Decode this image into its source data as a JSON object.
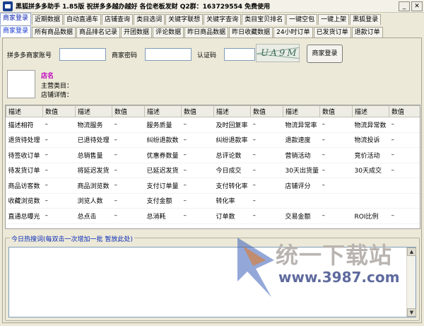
{
  "window": {
    "title": "黑狐拼多多助手   1.85版   祝拼多多越办越好   各位老板发财   Q2群：163729554 免费使用",
    "min_glyph": "_",
    "close_glyph": "✕"
  },
  "main_tabs": [
    {
      "label": "商家登录",
      "active": true
    },
    {
      "label": "近期数据"
    },
    {
      "label": "自动直通车"
    },
    {
      "label": "店铺查询"
    },
    {
      "label": "类目选词"
    },
    {
      "label": "关键字联想"
    },
    {
      "label": "关键字查询"
    },
    {
      "label": "类目宝贝排名"
    },
    {
      "label": "一键空包"
    },
    {
      "label": "一键上架"
    },
    {
      "label": "黑狐登录"
    }
  ],
  "sub_tabs": [
    {
      "label": "商家登录",
      "active": true
    },
    {
      "label": "所有商品数据"
    },
    {
      "label": "商品排名记录"
    },
    {
      "label": "开团数据"
    },
    {
      "label": "评论数据"
    },
    {
      "label": "昨日商品数据"
    },
    {
      "label": "昨日收藏数据"
    },
    {
      "label": "24小时订单"
    },
    {
      "label": "已发货订单"
    },
    {
      "label": "退款订单"
    }
  ],
  "login": {
    "account_label": "拼多多商家账号",
    "account_value": "",
    "password_label": "商家密码",
    "password_value": "",
    "captcha_label": "认证码",
    "captcha_value": "",
    "captcha_image_text": "UA9M",
    "button_label": "商家登录"
  },
  "shop": {
    "name_label": "店名",
    "category_label": "主营类目：",
    "details_label": "店铺详情："
  },
  "stats_table": {
    "headers": [
      "描述",
      "数值",
      "描述",
      "数值",
      "描述",
      "数值",
      "描述",
      "数值",
      "描述",
      "数值",
      "描述",
      "数值"
    ],
    "rows": [
      [
        "描述相符",
        "–",
        "物流服务",
        "–",
        "服务质量",
        "–",
        "及时回复率",
        "–",
        "物流异常率",
        "–",
        "物流异常数",
        "–"
      ],
      [
        "退货待处理",
        "–",
        "已退待处理",
        "–",
        "纠纷退款数",
        "–",
        "纠纷退款率",
        "–",
        "退款速度",
        "–",
        "物流投诉",
        "–"
      ],
      [
        "待签收订单",
        "–",
        "总销售量",
        "–",
        "优惠券数量",
        "–",
        "总评论数",
        "–",
        "营销活动",
        "–",
        "竞价活动",
        "–"
      ],
      [
        "待发货订单",
        "–",
        "将延迟发货",
        "–",
        "已延迟发货",
        "–",
        "今日成交",
        "–",
        "30天出货量",
        "–",
        "30天成交",
        "–"
      ],
      [
        "商品访客数",
        "–",
        "商品浏览数",
        "–",
        "支付订单量",
        "–",
        "支付转化率",
        "–",
        "店铺评分",
        "–",
        "",
        ""
      ],
      [
        "收藏浏览数",
        "–",
        "浏览人数",
        "–",
        "支付金额",
        "–",
        "转化率",
        "–",
        "",
        "",
        "",
        ""
      ],
      [
        "直通总曝光",
        "–",
        "总点击",
        "–",
        "总消耗",
        "–",
        "订单数",
        "–",
        "交易金额",
        "–",
        "ROI比例",
        "–"
      ]
    ]
  },
  "hot_words": {
    "legend": "今日热搜词(每双击一次增加一批   暂放此处)",
    "up_arrow": "▲",
    "down_arrow": "▼"
  },
  "watermark": {
    "text": "统一下载站",
    "url": "www.3987.com"
  },
  "colors": {
    "active_tab_text": "#0b1fb0",
    "shop_name": "#c000c0",
    "legend_text": "#0a2ab8",
    "window_bg": "#ece9d8"
  }
}
